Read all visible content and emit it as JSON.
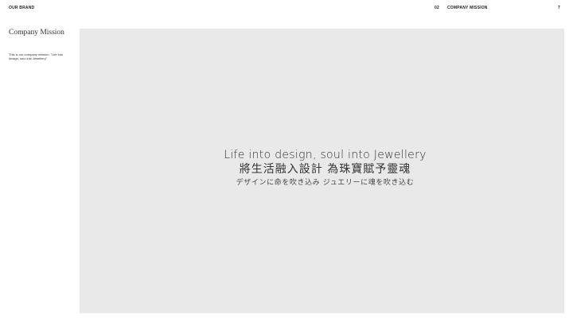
{
  "header": {
    "brand_label": "OUR BRAND",
    "section_number": "02",
    "section_title": "COMPANY MISSION",
    "page_number": "7"
  },
  "sidebar": {
    "title": "Company Mission",
    "description": "This is our company mission: \"Life into design, soul into Jewellery\""
  },
  "main": {
    "tagline_en": "Life into design, soul into Jewellery",
    "tagline_zh": "將生活融入設計 為珠寶賦予靈魂",
    "tagline_ja": "デザインに命を吹き込み ジュエリーに魂を吹き込む"
  }
}
